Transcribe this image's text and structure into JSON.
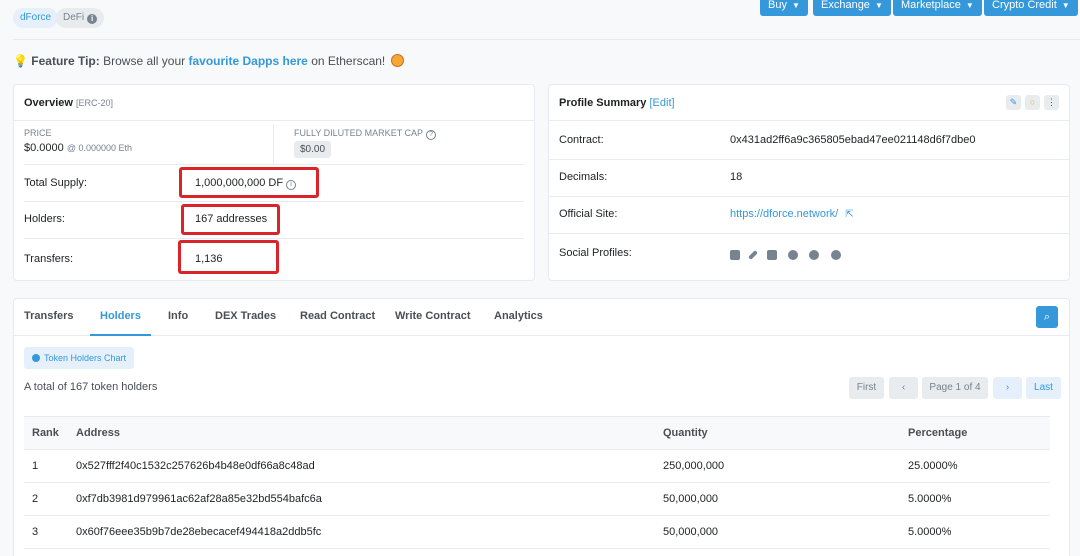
{
  "tags": {
    "project": "dForce",
    "category": "DeFi"
  },
  "top_buttons": [
    "Buy",
    "Exchange",
    "Marketplace",
    "Crypto Credit"
  ],
  "feature_tip": {
    "label": "Feature Tip:",
    "text_before": "Browse all your",
    "link": "favourite Dapps here",
    "text_after": "on Etherscan!"
  },
  "overview": {
    "title": "Overview",
    "subtitle": "[ERC-20]",
    "price_label": "PRICE",
    "price_value": "$0.0000",
    "price_eth": "@ 0.000000 Eth",
    "mcap_label": "FULLY DILUTED MARKET CAP",
    "mcap_value": "$0.00",
    "total_supply_label": "Total Supply:",
    "total_supply_value": "1,000,000,000 DF",
    "holders_label": "Holders:",
    "holders_value": "167 addresses",
    "transfers_label": "Transfers:",
    "transfers_value": "1,136"
  },
  "profile": {
    "title": "Profile Summary",
    "edit": "[Edit]",
    "contract_label": "Contract:",
    "contract_value": "0x431ad2ff6a9c365805ebad47ee021148d6f7dbe0",
    "decimals_label": "Decimals:",
    "decimals_value": "18",
    "site_label": "Official Site:",
    "site_value": "https://dforce.network/",
    "social_label": "Social Profiles:",
    "social_icons": [
      "email-icon",
      "pencil-icon",
      "blog-icon",
      "twitter-icon",
      "github-icon",
      "telegram-icon"
    ]
  },
  "tabs": [
    "Transfers",
    "Holders",
    "Info",
    "DEX Trades",
    "Read Contract",
    "Write Contract",
    "Analytics"
  ],
  "active_tab": "Holders",
  "holders": {
    "chart_button": "Token Holders Chart",
    "total_text": "A total of 167 token holders",
    "pagination": {
      "first": "First",
      "page": "Page 1 of 4",
      "last": "Last"
    },
    "columns": [
      "Rank",
      "Address",
      "Quantity",
      "Percentage"
    ],
    "rows": [
      {
        "rank": "1",
        "address": "0x527fff2f40c1532c257626b4b48e0df66a8c48ad",
        "quantity": "250,000,000",
        "percentage": "25.0000%"
      },
      {
        "rank": "2",
        "address": "0xf7db3981d979961ac62af28a85e32bd554bafc6a",
        "quantity": "50,000,000",
        "percentage": "5.0000%"
      },
      {
        "rank": "3",
        "address": "0x60f76eee35b9b7de28ebecacef494418a2ddb5fc",
        "quantity": "50,000,000",
        "percentage": "5.0000%"
      }
    ]
  },
  "colors": {
    "accent": "#3498db",
    "highlight_box": "#d9252a",
    "page_bg": "#f8f9fa"
  }
}
